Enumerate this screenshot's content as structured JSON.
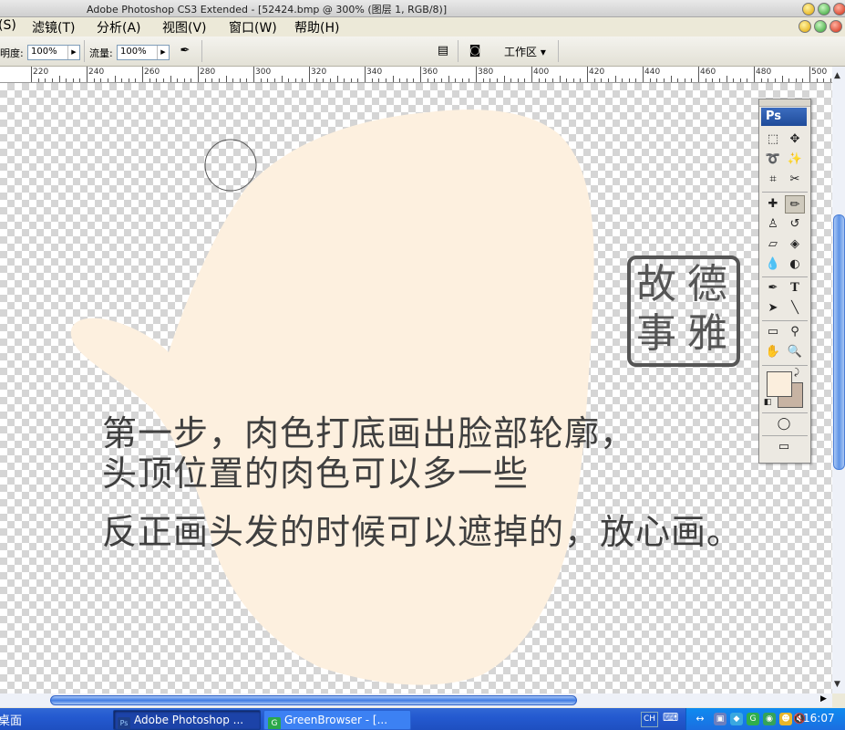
{
  "window": {
    "title": "Adobe Photoshop CS3 Extended - [52424.bmp @ 300% (图层 1, RGB/8)]"
  },
  "menu": {
    "items": [
      "(S)",
      "滤镜(T)",
      "分析(A)",
      "视图(V)",
      "窗口(W)",
      "帮助(H)"
    ]
  },
  "options_bar": {
    "opacity_label": "明度:",
    "opacity_value": "100%",
    "flow_label": "流量:",
    "flow_value": "100%",
    "workspace_label": "工作区 ▾"
  },
  "ruler": {
    "labels": [
      "220",
      "240",
      "260",
      "280",
      "300",
      "320",
      "340",
      "360",
      "380",
      "400",
      "420",
      "440",
      "460",
      "480",
      "500"
    ]
  },
  "canvas": {
    "skin_color": "#fdf0df",
    "caption_lines": [
      "第一步，肉色打底画出脸部轮廓，",
      "头顶位置的肉色可以多一些",
      "反正画头发的时候可以遮掉的，放心画。"
    ],
    "seal_chars": [
      "故",
      "德",
      "事",
      "雅"
    ]
  },
  "tools": {
    "logo": "Ps",
    "foreground_color": "#fbeedd",
    "background_color": "#c7b3a3",
    "icons": [
      "marquee-icon",
      "move-icon",
      "lasso-icon",
      "magic-wand-icon",
      "crop-icon",
      "slice-icon",
      "healing-icon",
      "brush-icon",
      "stamp-icon",
      "history-brush-icon",
      "eraser-icon",
      "paint-bucket-icon",
      "blur-icon",
      "dodge-icon",
      "pen-icon",
      "type-icon",
      "path-select-icon",
      "line-icon",
      "notes-icon",
      "eyedropper-icon",
      "hand-icon",
      "zoom-icon"
    ]
  },
  "taskbar": {
    "left_label": "桌面",
    "buttons": [
      {
        "label": "Adobe Photoshop ...",
        "active": true
      },
      {
        "label": "GreenBrowser - [...",
        "active": false
      }
    ],
    "lang": "CH",
    "clock": "16:07"
  }
}
